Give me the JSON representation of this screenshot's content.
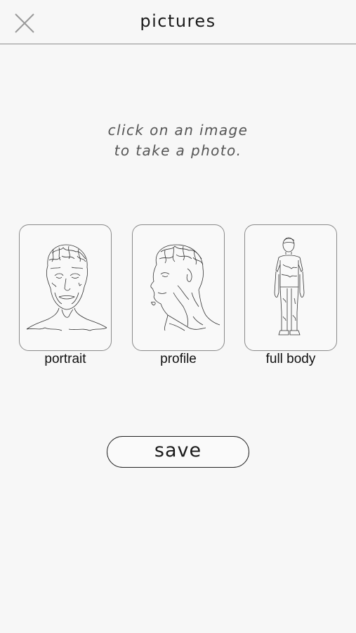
{
  "header": {
    "title": "pictures",
    "close_icon": "close-icon"
  },
  "instructions": {
    "line1": "click on an image",
    "line2": "to take a photo."
  },
  "photos": [
    {
      "label": "portrait",
      "icon": "portrait-sketch"
    },
    {
      "label": "profile",
      "icon": "profile-sketch"
    },
    {
      "label": "full body",
      "icon": "full-body-sketch"
    }
  ],
  "save_button": {
    "label": "save"
  }
}
